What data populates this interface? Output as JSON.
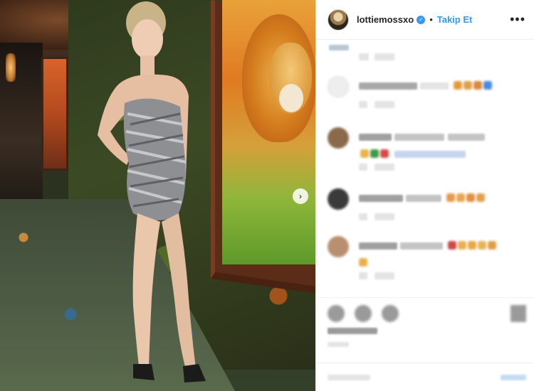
{
  "post": {
    "carousel_next_icon": "chevron-right-icon"
  },
  "header": {
    "username": "lottiemossxo",
    "verified_icon": "verified-badge-icon",
    "separator": "•",
    "follow_label": "Takip Et",
    "more_icon": "ellipsis-icon"
  },
  "colors": {
    "accent": "#3897f0",
    "text": "#262626",
    "border": "#efefef"
  },
  "actions": {
    "icons": [
      "heart-icon",
      "comment-icon",
      "share-icon",
      "bookmark-icon"
    ]
  }
}
